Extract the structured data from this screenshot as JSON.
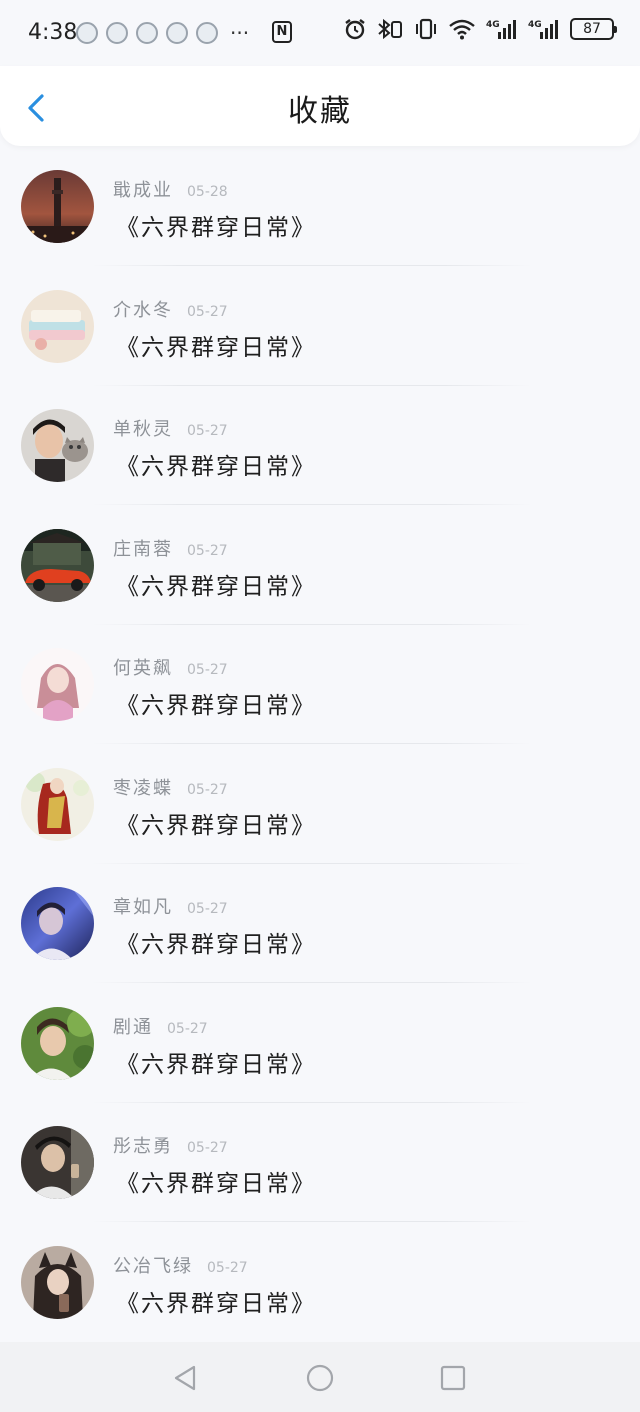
{
  "status_bar": {
    "time": "4:38",
    "more": "···",
    "nfc": "N",
    "battery": "87",
    "signal_label": "4G",
    "icons": [
      "alarm-icon",
      "bluetooth-icon",
      "vibrate-icon",
      "wifi-icon",
      "signal-4g-icon",
      "signal-4g-icon",
      "battery-icon"
    ]
  },
  "header": {
    "title": "收藏",
    "back_icon": "chevron-left-icon",
    "accent_color": "#2a8fe0"
  },
  "favorites": [
    {
      "name": "戢成业",
      "date": "05-28",
      "title": "《六界群穿日常》",
      "avatar": "city-tower-night"
    },
    {
      "name": "介水冬",
      "date": "05-27",
      "title": "《六界群穿日常》",
      "avatar": "notebook-pastel"
    },
    {
      "name": "单秋灵",
      "date": "05-27",
      "title": "《六界群穿日常》",
      "avatar": "boy-with-cat"
    },
    {
      "name": "庄南蓉",
      "date": "05-27",
      "title": "《六界群穿日常》",
      "avatar": "red-sports-car"
    },
    {
      "name": "何英飙",
      "date": "05-27",
      "title": "《六界群穿日常》",
      "avatar": "anime-girl-pink"
    },
    {
      "name": "枣凌蝶",
      "date": "05-27",
      "title": "《六界群穿日常》",
      "avatar": "red-robe-figure"
    },
    {
      "name": "章如凡",
      "date": "05-27",
      "title": "《六界群穿日常》",
      "avatar": "boy-blue-light"
    },
    {
      "name": "剧通",
      "date": "05-27",
      "title": "《六界群穿日常》",
      "avatar": "young-man-green"
    },
    {
      "name": "彤志勇",
      "date": "05-27",
      "title": "《六界群穿日常》",
      "avatar": "man-dark-cap"
    },
    {
      "name": "公冶飞绿",
      "date": "05-27",
      "title": "《六界群穿日常》",
      "avatar": "girl-cat-ears"
    }
  ],
  "nav_bar": {
    "buttons": [
      "back-triangle-icon",
      "home-circle-icon",
      "recent-square-icon"
    ]
  }
}
